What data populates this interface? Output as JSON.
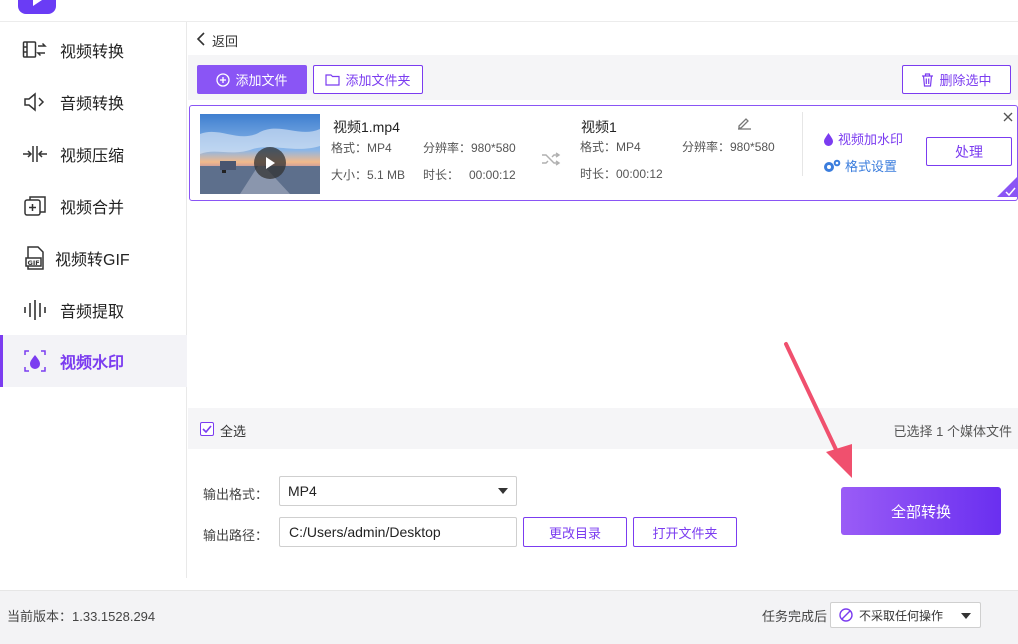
{
  "sidebar": {
    "items": [
      {
        "label": "视频转换",
        "icon": "video-convert-icon"
      },
      {
        "label": "音频转换",
        "icon": "audio-convert-icon"
      },
      {
        "label": "视频压缩",
        "icon": "compress-icon"
      },
      {
        "label": "视频合并",
        "icon": "merge-icon"
      },
      {
        "label": "视频转GIF",
        "icon": "gif-icon"
      },
      {
        "label": "音频提取",
        "icon": "waveform-icon"
      },
      {
        "label": "视频水印",
        "icon": "watermark-icon",
        "active": true
      }
    ]
  },
  "nav": {
    "back_label": "返回"
  },
  "toolbar": {
    "add_file": "添加文件",
    "add_folder": "添加文件夹",
    "delete_selected": "删除选中"
  },
  "file": {
    "source": {
      "name": "视频1.mp4",
      "format": "格式：MP4",
      "resolution": "分辨率：980*580",
      "size": "大小：5.1 MB",
      "duration": "时长：   00:00:12"
    },
    "output": {
      "name": "视频1",
      "format": "格式：MP4",
      "resolution": "分辨率：980*580",
      "duration": "时长：00:00:12"
    },
    "actions": {
      "watermark": "视频加水印",
      "format_settings": "格式设置",
      "process": "处理"
    }
  },
  "selection": {
    "select_all": "全选",
    "select_all_checked": true,
    "count_text": "已选择 1 个媒体文件"
  },
  "output": {
    "format_label": "输出格式：",
    "format_value": "MP4",
    "path_label": "输出路径：",
    "path_value": "C:/Users/admin/Desktop",
    "change_dir": "更改目录",
    "open_folder": "打开文件夹"
  },
  "convert_all": "全部转换",
  "status": {
    "version": "当前版本：1.33.1528.294",
    "after_label": "任务完成后",
    "after_value": "不采取任何操作"
  },
  "colors": {
    "accent": "#7b3cf0",
    "link_blue": "#3b7ddd",
    "arrow": "#f0506e"
  }
}
